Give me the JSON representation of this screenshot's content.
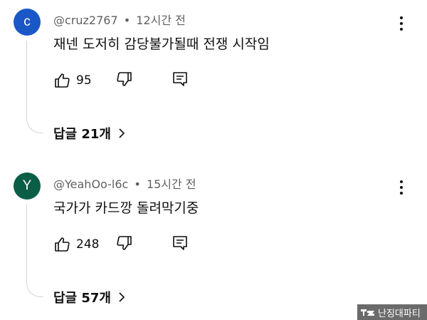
{
  "comments": [
    {
      "avatar_letter": "c",
      "avatar_color": "#1a57c6",
      "username": "@cruz2767",
      "separator": "•",
      "time": "12시간 전",
      "text": "재넨 도저히 감당불가될때 전쟁 시작임",
      "like_count": "95",
      "replies_label": "답글 21개"
    },
    {
      "avatar_letter": "Y",
      "avatar_color": "#0b5e46",
      "username": "@YeahOo-l6c",
      "separator": "•",
      "time": "15시간 전",
      "text": "국가가 카드깡 돌려막기중",
      "like_count": "248",
      "replies_label": "답글 57개"
    }
  ],
  "icons": {
    "like": "thumb-up-icon",
    "dislike": "thumb-down-icon",
    "reply": "comment-reply-icon",
    "more": "more-vert-icon",
    "chevron": "chevron-right-icon"
  },
  "watermark": {
    "text": "난징대파티"
  }
}
